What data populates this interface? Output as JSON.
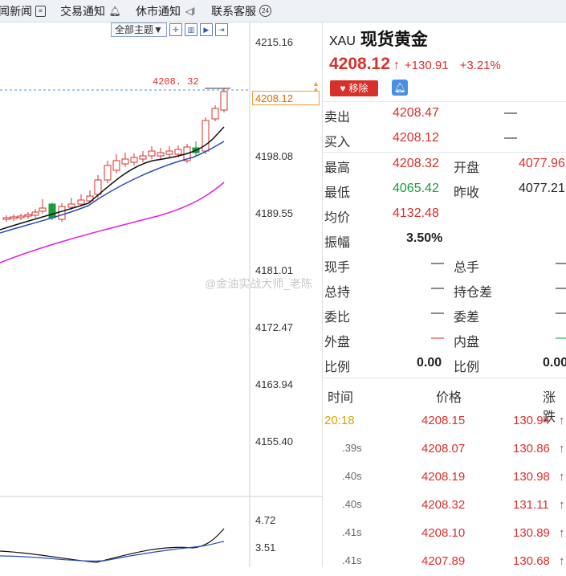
{
  "topbar": {
    "items": [
      {
        "label": "闻新闻",
        "icon": "news-icon"
      },
      {
        "label": "交易通知",
        "icon": "bell-icon"
      },
      {
        "label": "休市通知",
        "icon": "speaker-icon"
      },
      {
        "label": "联系客服",
        "icon": "support-24-icon"
      }
    ],
    "support_badge": "24"
  },
  "chart": {
    "theme_select": "全部主题▼",
    "y_ticks": [
      "4215.16",
      "4198.08",
      "4189.55",
      "4181.01",
      "4172.47",
      "4163.94",
      "4155.40"
    ],
    "current_price_tag": "4208.12",
    "high_tag": "4208. 32",
    "indicator_ticks": [
      "4.72",
      "3.51"
    ],
    "colors": {
      "up": "#d9302c",
      "down": "#1a9c3a",
      "ma_long": "#e020e0",
      "ma_fast": "#111111",
      "ma_mid": "#2a4cb8"
    }
  },
  "watermark": "@金油实战大师_老陈",
  "quote": {
    "code": "XAU",
    "name": "现货黄金",
    "price": "4208.12",
    "arrow": "↑",
    "change": "+130.91",
    "change_pct": "+3.21%",
    "remove_button": "移除"
  },
  "book": [
    {
      "label": "卖出",
      "value": "4208.47",
      "extra": "—"
    },
    {
      "label": "买入",
      "value": "4208.12",
      "extra": "—"
    }
  ],
  "stats": [
    {
      "l1": "最高",
      "v1": "4208.32",
      "l2": "开盘",
      "v2": "4077.96"
    },
    {
      "l1": "最低",
      "v1": "4065.42",
      "l2": "昨收",
      "v2": "4077.21"
    },
    {
      "l1": "均价",
      "v1": "4132.48",
      "l2": "",
      "v2": ""
    },
    {
      "l1": "振幅",
      "v1": "3.50%",
      "l2": "",
      "v2": ""
    },
    {
      "l1": "现手",
      "v1": "—",
      "l2": "总手",
      "v2": "—"
    },
    {
      "l1": "总持",
      "v1": "—",
      "l2": "持仓差",
      "v2": "—"
    },
    {
      "l1": "委比",
      "v1": "—",
      "l2": "委差",
      "v2": "—"
    },
    {
      "l1": "外盘",
      "v1": "—",
      "l2": "内盘",
      "v2": "—"
    },
    {
      "l1": "比例",
      "v1": "0.00",
      "l2": "比例",
      "v2": "0.00"
    }
  ],
  "ticks": {
    "headers": [
      "时间",
      "价格",
      "涨跌"
    ],
    "rows": [
      {
        "time": "20:18",
        "price": "4208.15",
        "change": "130.94",
        "arrow": "↑"
      },
      {
        "time": ".39s",
        "price": "4208.07",
        "change": "130.86",
        "arrow": "↑"
      },
      {
        "time": ".40s",
        "price": "4208.19",
        "change": "130.98",
        "arrow": "↑"
      },
      {
        "time": ".40s",
        "price": "4208.32",
        "change": "131.11",
        "arrow": "↑"
      },
      {
        "time": ".41s",
        "price": "4208.10",
        "change": "130.89",
        "arrow": "↑"
      },
      {
        "time": ".41s",
        "price": "4207.89",
        "change": "130.68",
        "arrow": "↑"
      }
    ]
  }
}
